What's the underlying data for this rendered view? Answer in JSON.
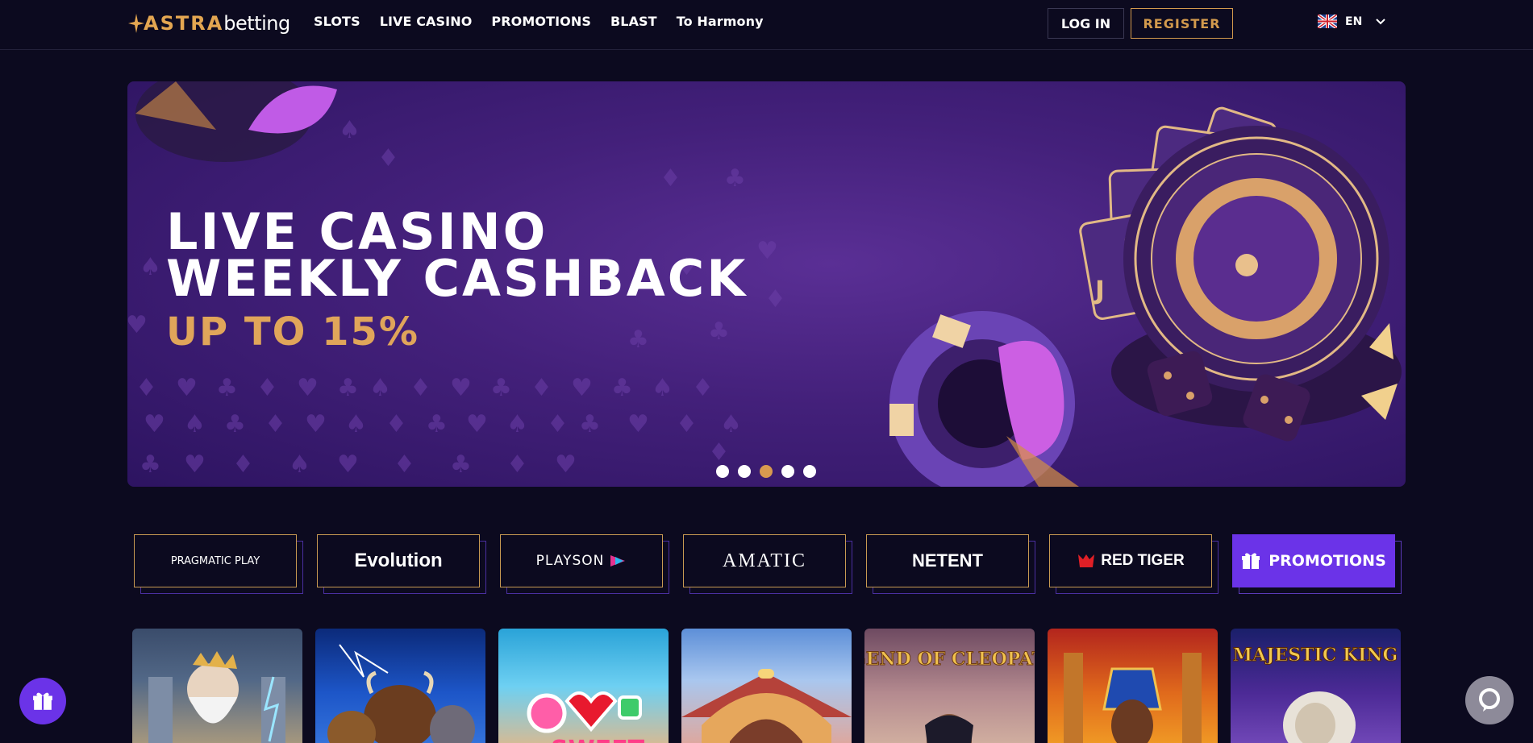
{
  "header": {
    "logo_astra": "ASTRA",
    "logo_betting": "betting",
    "nav": [
      "SLOTS",
      "LIVE CASINO",
      "PROMOTIONS",
      "BLAST",
      "To Harmony"
    ],
    "login_label": "LOG IN",
    "register_label": "REGISTER",
    "language": "EN"
  },
  "banner": {
    "title_line1": "LIVE CASINO",
    "title_line2": "WEEKLY CASHBACK",
    "subtitle": "UP TO 15%",
    "slide_count": 5,
    "active_slide": 3
  },
  "providers": [
    {
      "name": "PRAGMATIC PLAY"
    },
    {
      "name": "Evolution"
    },
    {
      "name": "PLAYSON"
    },
    {
      "name": "AMATIC"
    },
    {
      "name": "NETENT"
    },
    {
      "name": "RED TIGER"
    },
    {
      "name": "PROMOTIONS"
    }
  ],
  "games": [
    {
      "title": ""
    },
    {
      "title": ""
    },
    {
      "title": "SWEET"
    },
    {
      "title": ""
    },
    {
      "title": "LEGEND OF CLEOPATRA"
    },
    {
      "title": ""
    },
    {
      "title": "MAJESTIC KING"
    }
  ],
  "colors": {
    "background": "#0c0a1f",
    "accent_gold": "#d39a4d",
    "accent_purple": "#6b33e8"
  }
}
